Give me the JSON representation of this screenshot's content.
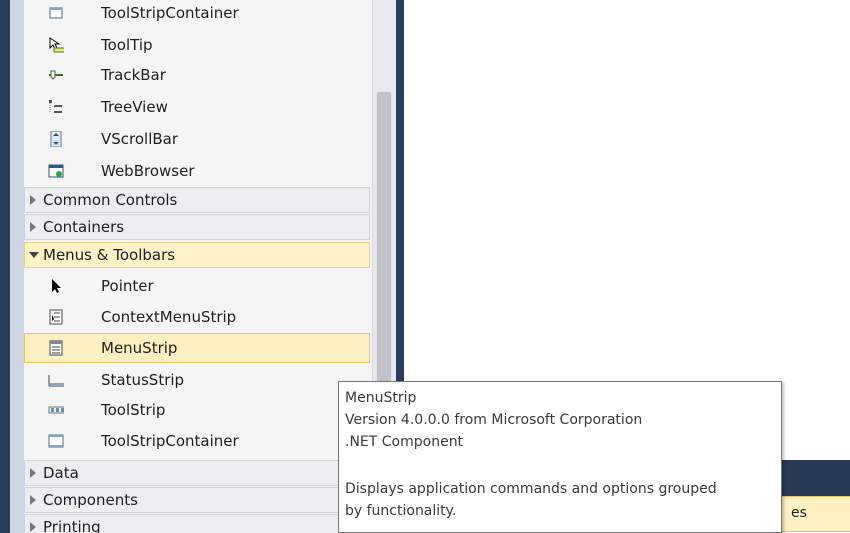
{
  "toolbox": {
    "items_top": [
      {
        "label": "ToolStripContainer",
        "icon": "toolstripcontainer-icon"
      },
      {
        "label": "ToolTip",
        "icon": "tooltip-icon"
      },
      {
        "label": "TrackBar",
        "icon": "trackbar-icon"
      },
      {
        "label": "TreeView",
        "icon": "treeview-icon"
      },
      {
        "label": "VScrollBar",
        "icon": "vscrollbar-icon"
      },
      {
        "label": "WebBrowser",
        "icon": "webbrowser-icon"
      }
    ],
    "categories": [
      {
        "label": "Common Controls",
        "expanded": false
      },
      {
        "label": "Containers",
        "expanded": false
      },
      {
        "label": "Menus & Toolbars",
        "expanded": true
      }
    ],
    "menu_items": [
      {
        "label": "Pointer",
        "icon": "pointer-icon"
      },
      {
        "label": "ContextMenuStrip",
        "icon": "contextmenustrip-icon"
      },
      {
        "label": "MenuStrip",
        "icon": "menustrip-icon",
        "selected": true
      },
      {
        "label": "StatusStrip",
        "icon": "statusstrip-icon"
      },
      {
        "label": "ToolStrip",
        "icon": "toolstrip-icon"
      },
      {
        "label": "ToolStripContainer",
        "icon": "toolstripcontainer-icon"
      }
    ],
    "categories_bottom": [
      {
        "label": "Data",
        "expanded": false
      },
      {
        "label": "Components",
        "expanded": false
      },
      {
        "label": "Printing",
        "expanded": false
      }
    ]
  },
  "tooltip": {
    "title": "MenuStrip",
    "version": "Version 4.0.0.0 from Microsoft Corporation",
    "type": ".NET Component",
    "description_line1": "Displays application commands and options grouped",
    "description_line2": "by functionality."
  },
  "bottom_tab": {
    "label_fragment": "es"
  },
  "colors": {
    "frame_dark": "#2b3c5d",
    "selected_bg": "#fdf0c0",
    "selected_border": "#e5c365",
    "category_bg": "#eeeef2"
  }
}
